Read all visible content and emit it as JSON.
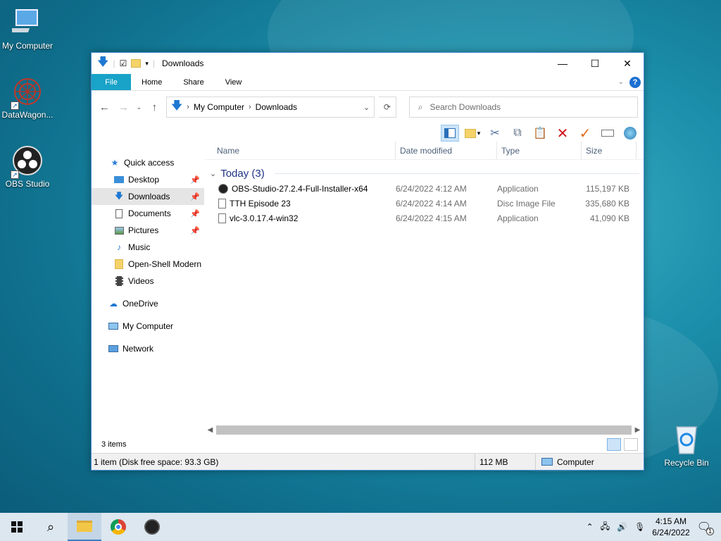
{
  "desktop": {
    "icons": [
      {
        "label": "My Computer",
        "icon": "computer-icon"
      },
      {
        "label": "DataWagon...",
        "icon": "datawagon-icon"
      },
      {
        "label": "OBS Studio",
        "icon": "obs-icon"
      },
      {
        "label": "Recycle Bin",
        "icon": "recycle-bin-icon"
      }
    ]
  },
  "window": {
    "title": "Downloads",
    "ribbon_tabs": [
      "File",
      "Home",
      "Share",
      "View"
    ],
    "address": {
      "segments": [
        "My Computer",
        "Downloads"
      ]
    },
    "search": {
      "placeholder": "Search Downloads"
    },
    "sidebar": [
      {
        "label": "Quick access",
        "icon": "star-icon"
      },
      {
        "label": "Desktop",
        "icon": "desktop-icon",
        "pinned": true
      },
      {
        "label": "Downloads",
        "icon": "download-icon",
        "pinned": true,
        "selected": true
      },
      {
        "label": "Documents",
        "icon": "documents-icon",
        "pinned": true
      },
      {
        "label": "Pictures",
        "icon": "pictures-icon",
        "pinned": true
      },
      {
        "label": "Music",
        "icon": "music-icon"
      },
      {
        "label": "Open-Shell Modern",
        "icon": "folder-icon"
      },
      {
        "label": "Videos",
        "icon": "videos-icon"
      },
      {
        "label": "OneDrive",
        "icon": "onedrive-icon"
      },
      {
        "label": "My Computer",
        "icon": "computer-icon"
      },
      {
        "label": "Network",
        "icon": "network-icon"
      }
    ],
    "columns": [
      "Name",
      "Date modified",
      "Type",
      "Size"
    ],
    "group": "Today (3)",
    "files": [
      {
        "name": "OBS-Studio-27.2.4-Full-Installer-x64",
        "date": "6/24/2022 4:12 AM",
        "type": "Application",
        "size": "115,197 KB",
        "icon": "obs-icon"
      },
      {
        "name": "TTH Episode 23",
        "date": "6/24/2022 4:14 AM",
        "type": "Disc Image File",
        "size": "335,680 KB",
        "icon": "disc-image-icon"
      },
      {
        "name": "vlc-3.0.17.4-win32",
        "date": "6/24/2022 4:15 AM",
        "type": "Application",
        "size": "41,090 KB",
        "icon": "file-icon"
      }
    ],
    "item_count": "3 items",
    "status": {
      "selection": "1 item (Disk free space: 93.3 GB)",
      "size": "112 MB",
      "location": "Computer"
    }
  },
  "taskbar": {
    "time": "4:15 AM",
    "date": "6/24/2022",
    "notification_count": "1"
  }
}
